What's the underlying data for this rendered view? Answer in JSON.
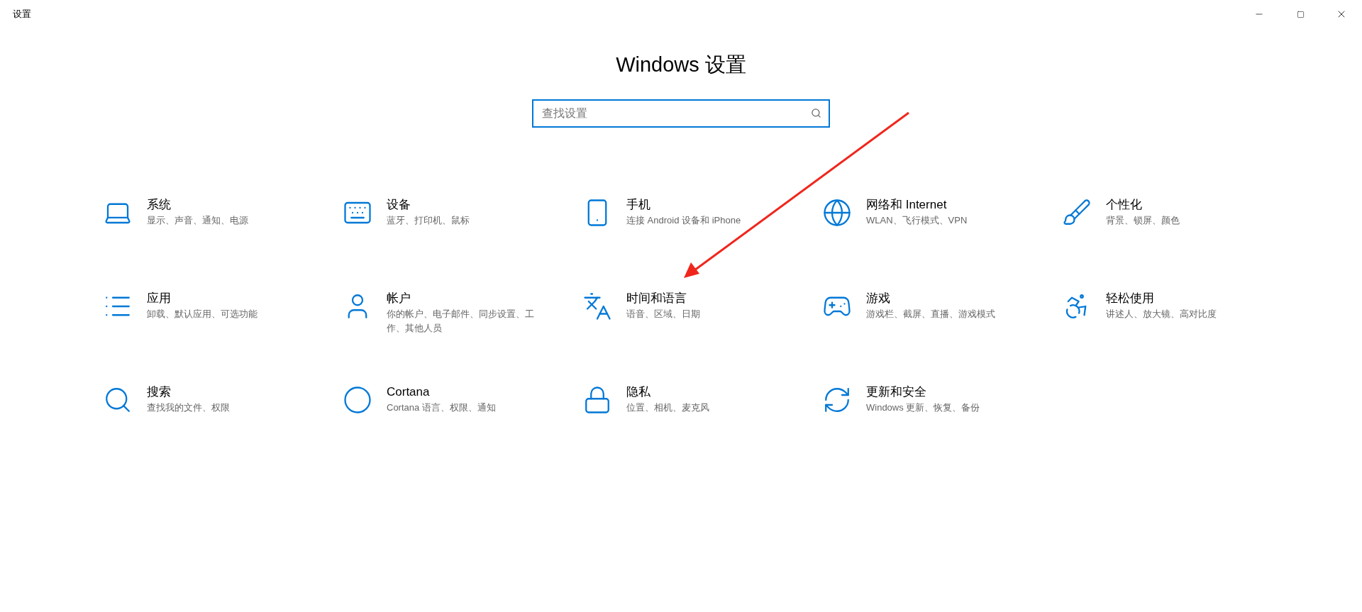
{
  "window": {
    "title": "设置"
  },
  "heading": "Windows 设置",
  "search": {
    "placeholder": "查找设置"
  },
  "categories": [
    {
      "name": "系统",
      "description": "显示、声音、通知、电源"
    },
    {
      "name": "设备",
      "description": "蓝牙、打印机、鼠标"
    },
    {
      "name": "手机",
      "description": "连接 Android 设备和 iPhone"
    },
    {
      "name": "网络和 Internet",
      "description": "WLAN、飞行模式、VPN"
    },
    {
      "name": "个性化",
      "description": "背景、锁屏、颜色"
    },
    {
      "name": "应用",
      "description": "卸载、默认应用、可选功能"
    },
    {
      "name": "帐户",
      "description": "你的帐户、电子邮件、同步设置、工作、其他人员"
    },
    {
      "name": "时间和语言",
      "description": "语音、区域、日期"
    },
    {
      "name": "游戏",
      "description": "游戏栏、截屏、直播、游戏模式"
    },
    {
      "name": "轻松使用",
      "description": "讲述人、放大镜、高对比度"
    },
    {
      "name": "搜索",
      "description": "查找我的文件、权限"
    },
    {
      "name": "Cortana",
      "description": "Cortana 语言、权限、通知"
    },
    {
      "name": "隐私",
      "description": "位置、相机、麦克风"
    },
    {
      "name": "更新和安全",
      "description": "Windows 更新、恢复、备份"
    }
  ]
}
